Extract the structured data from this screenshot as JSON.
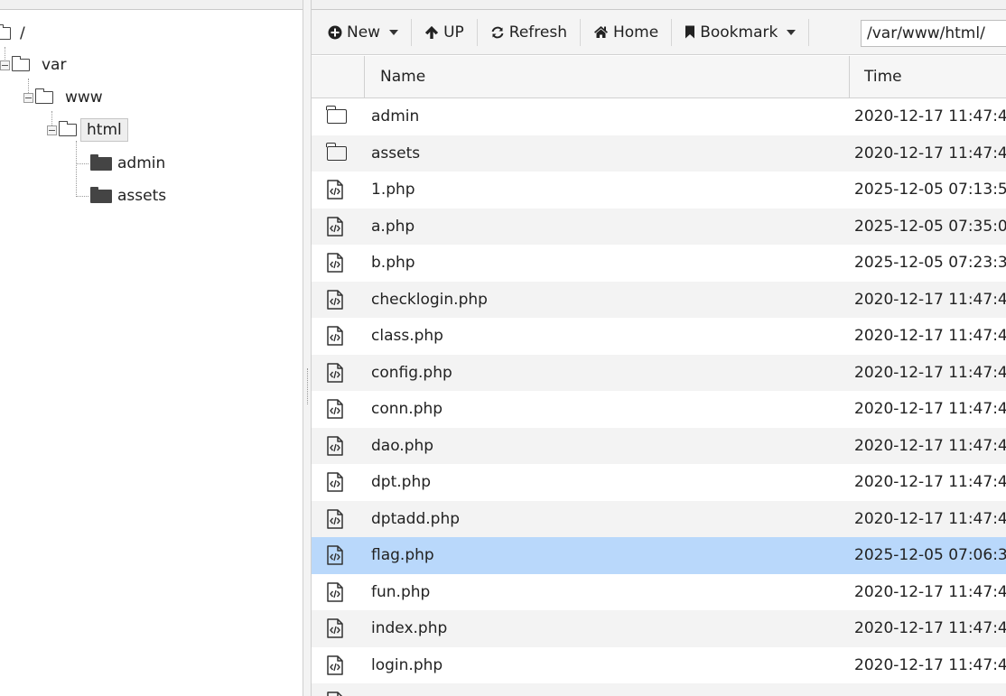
{
  "tree": {
    "root": {
      "label": "/"
    },
    "nodes": [
      {
        "label": "var"
      },
      {
        "label": "www"
      },
      {
        "label": "html"
      },
      {
        "label": "admin"
      },
      {
        "label": "assets"
      }
    ]
  },
  "toolbar": {
    "new_label": "New",
    "up_label": "UP",
    "refresh_label": "Refresh",
    "home_label": "Home",
    "bookmark_label": "Bookmark",
    "path_value": "/var/www/html/"
  },
  "grid": {
    "columns": {
      "name": "Name",
      "time": "Time"
    },
    "rows": [
      {
        "name": "admin",
        "time": "2020-12-17 11:47:4",
        "type": "folder"
      },
      {
        "name": "assets",
        "time": "2020-12-17 11:47:4",
        "type": "folder"
      },
      {
        "name": "1.php",
        "time": "2025-12-05 07:13:5",
        "type": "code"
      },
      {
        "name": "a.php",
        "time": "2025-12-05 07:35:0",
        "type": "code"
      },
      {
        "name": "b.php",
        "time": "2025-12-05 07:23:3",
        "type": "code"
      },
      {
        "name": "checklogin.php",
        "time": "2020-12-17 11:47:4",
        "type": "code"
      },
      {
        "name": "class.php",
        "time": "2020-12-17 11:47:4",
        "type": "code"
      },
      {
        "name": "config.php",
        "time": "2020-12-17 11:47:4",
        "type": "code"
      },
      {
        "name": "conn.php",
        "time": "2020-12-17 11:47:4",
        "type": "code"
      },
      {
        "name": "dao.php",
        "time": "2020-12-17 11:47:4",
        "type": "code"
      },
      {
        "name": "dpt.php",
        "time": "2020-12-17 11:47:4",
        "type": "code"
      },
      {
        "name": "dptadd.php",
        "time": "2020-12-17 11:47:4",
        "type": "code"
      },
      {
        "name": "flag.php",
        "time": "2025-12-05 07:06:3",
        "type": "code",
        "selected": true
      },
      {
        "name": "fun.php",
        "time": "2020-12-17 11:47:4",
        "type": "code"
      },
      {
        "name": "index.php",
        "time": "2020-12-17 11:47:4",
        "type": "code"
      },
      {
        "name": "login.php",
        "time": "2020-12-17 11:47:4",
        "type": "code"
      }
    ]
  },
  "colors": {
    "selected_row": "#b9d8fb",
    "alt_row": "#f3f3f3",
    "toolbar_bg": "#f4f4f4"
  }
}
